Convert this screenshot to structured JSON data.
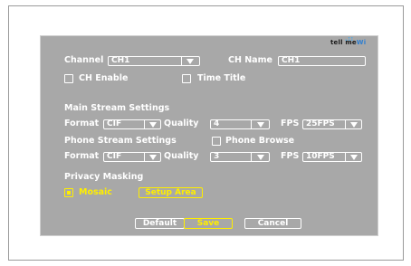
{
  "logo": {
    "text": "tell me",
    "suffix": "Wi"
  },
  "channel": {
    "label": "Channel",
    "value": "CH1"
  },
  "ch_name": {
    "label": "CH Name",
    "value": "CH1"
  },
  "ch_enable": {
    "label": "CH Enable"
  },
  "time_title": {
    "label": "Time Title"
  },
  "main_stream": {
    "heading": "Main Stream Settings",
    "format_label": "Format",
    "format_value": "CIF",
    "quality_label": "Quality",
    "quality_value": "4",
    "fps_label": "FPS",
    "fps_value": "25FPS"
  },
  "phone_stream": {
    "heading": "Phone Stream Settings",
    "browse_label": "Phone Browse",
    "format_label": "Format",
    "format_value": "CIF",
    "quality_label": "Quality",
    "quality_value": "3",
    "fps_label": "FPS",
    "fps_value": "10FPS"
  },
  "privacy": {
    "heading": "Privacy Masking",
    "mosaic_label": "Mosaic",
    "setup_area_label": "Setup Area"
  },
  "buttons": {
    "default": "Default",
    "save": "Save",
    "cancel": "Cancel"
  },
  "colors": {
    "panel": "#a8a8a8",
    "text": "#ffffff",
    "highlight": "#ffee00"
  }
}
